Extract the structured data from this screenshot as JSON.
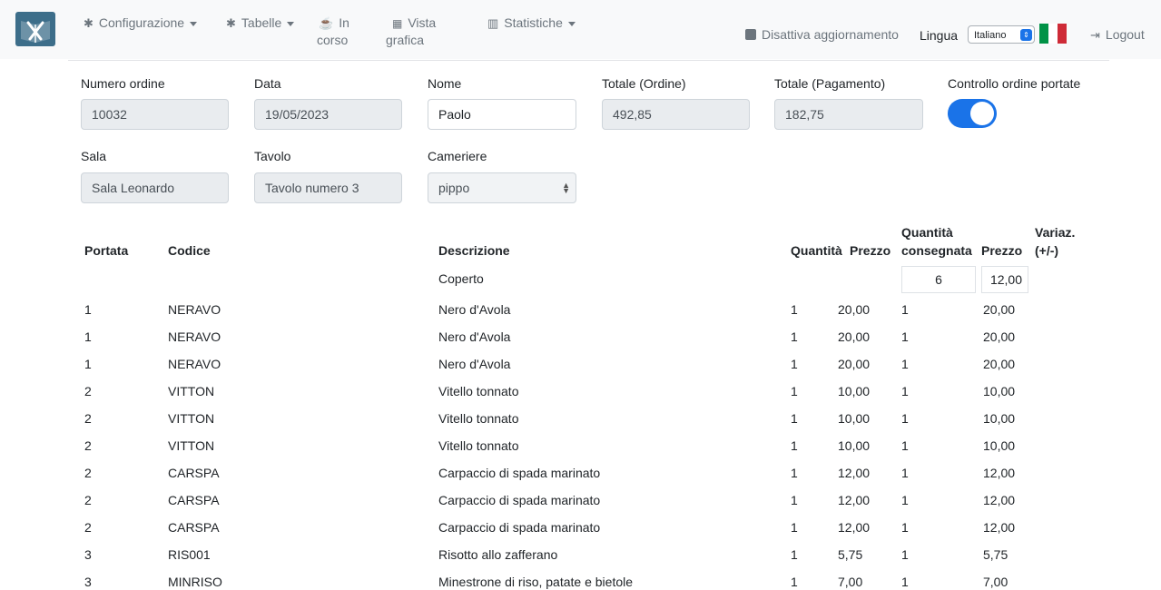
{
  "nav": {
    "items": [
      {
        "label": "Configurazione",
        "icon": "gear-icon"
      },
      {
        "label": "Tabelle",
        "icon": "gear-icon"
      },
      {
        "label": "In",
        "label2": "corso",
        "icon": "coffee-icon"
      },
      {
        "label": "Vista",
        "label2": "grafica",
        "icon": "grid-icon"
      },
      {
        "label": "Statistiche",
        "icon": "chart-icon"
      }
    ],
    "disable_update": "Disattiva aggiornamento",
    "language_label": "Lingua",
    "language_value": "Italiano",
    "logout": "Logout",
    "flag_colors": [
      "#009246",
      "#ffffff",
      "#ce2b37"
    ]
  },
  "form": {
    "numero_ordine_label": "Numero ordine",
    "numero_ordine": "10032",
    "data_label": "Data",
    "data": "19/05/2023",
    "nome_label": "Nome",
    "nome": "Paolo",
    "totale_ordine_label": "Totale (Ordine)",
    "totale_ordine": "492,85",
    "totale_pagamento_label": "Totale (Pagamento)",
    "totale_pagamento": "182,75",
    "controllo_label": "Controllo ordine portate",
    "controllo_enabled": true,
    "sala_label": "Sala",
    "sala": "Sala Leonardo",
    "tavolo_label": "Tavolo",
    "tavolo": "Tavolo numero 3",
    "cameriere_label": "Cameriere",
    "cameriere": "pippo"
  },
  "table": {
    "headers": {
      "portata": "Portata",
      "codice": "Codice",
      "descrizione": "Descrizione",
      "quantita": "Quantità",
      "prezzo": "Prezzo",
      "quantita_consegnata_1": "Quantità",
      "quantita_consegnata_2": "consegnata",
      "prezzo2": "Prezzo",
      "variaz_1": "Variaz.",
      "variaz_2": "(+/-)"
    },
    "coperto": {
      "descrizione": "Coperto",
      "quantita_consegnata": "6",
      "prezzo": "12,00"
    },
    "rows": [
      {
        "portata": "1",
        "codice": "NERAVO",
        "descrizione": "Nero d'Avola",
        "quantita": "1",
        "prezzo": "20,00",
        "consegnata": "1",
        "prezzo2": "20,00"
      },
      {
        "portata": "1",
        "codice": "NERAVO",
        "descrizione": "Nero d'Avola",
        "quantita": "1",
        "prezzo": "20,00",
        "consegnata": "1",
        "prezzo2": "20,00"
      },
      {
        "portata": "1",
        "codice": "NERAVO",
        "descrizione": "Nero d'Avola",
        "quantita": "1",
        "prezzo": "20,00",
        "consegnata": "1",
        "prezzo2": "20,00"
      },
      {
        "portata": "2",
        "codice": "VITTON",
        "descrizione": "Vitello tonnato",
        "quantita": "1",
        "prezzo": "10,00",
        "consegnata": "1",
        "prezzo2": "10,00"
      },
      {
        "portata": "2",
        "codice": "VITTON",
        "descrizione": "Vitello tonnato",
        "quantita": "1",
        "prezzo": "10,00",
        "consegnata": "1",
        "prezzo2": "10,00"
      },
      {
        "portata": "2",
        "codice": "VITTON",
        "descrizione": "Vitello tonnato",
        "quantita": "1",
        "prezzo": "10,00",
        "consegnata": "1",
        "prezzo2": "10,00"
      },
      {
        "portata": "2",
        "codice": "CARSPA",
        "descrizione": "Carpaccio di spada marinato",
        "quantita": "1",
        "prezzo": "12,00",
        "consegnata": "1",
        "prezzo2": "12,00"
      },
      {
        "portata": "2",
        "codice": "CARSPA",
        "descrizione": "Carpaccio di spada marinato",
        "quantita": "1",
        "prezzo": "12,00",
        "consegnata": "1",
        "prezzo2": "12,00"
      },
      {
        "portata": "2",
        "codice": "CARSPA",
        "descrizione": "Carpaccio di spada marinato",
        "quantita": "1",
        "prezzo": "12,00",
        "consegnata": "1",
        "prezzo2": "12,00"
      },
      {
        "portata": "3",
        "codice": "RIS001",
        "descrizione": "Risotto allo zafferano",
        "quantita": "1",
        "prezzo": "5,75",
        "consegnata": "1",
        "prezzo2": "5,75"
      },
      {
        "portata": "3",
        "codice": "MINRISO",
        "descrizione": "Minestrone di riso, patate e bietole",
        "quantita": "1",
        "prezzo": "7,00",
        "consegnata": "1",
        "prezzo2": "7,00"
      }
    ]
  }
}
